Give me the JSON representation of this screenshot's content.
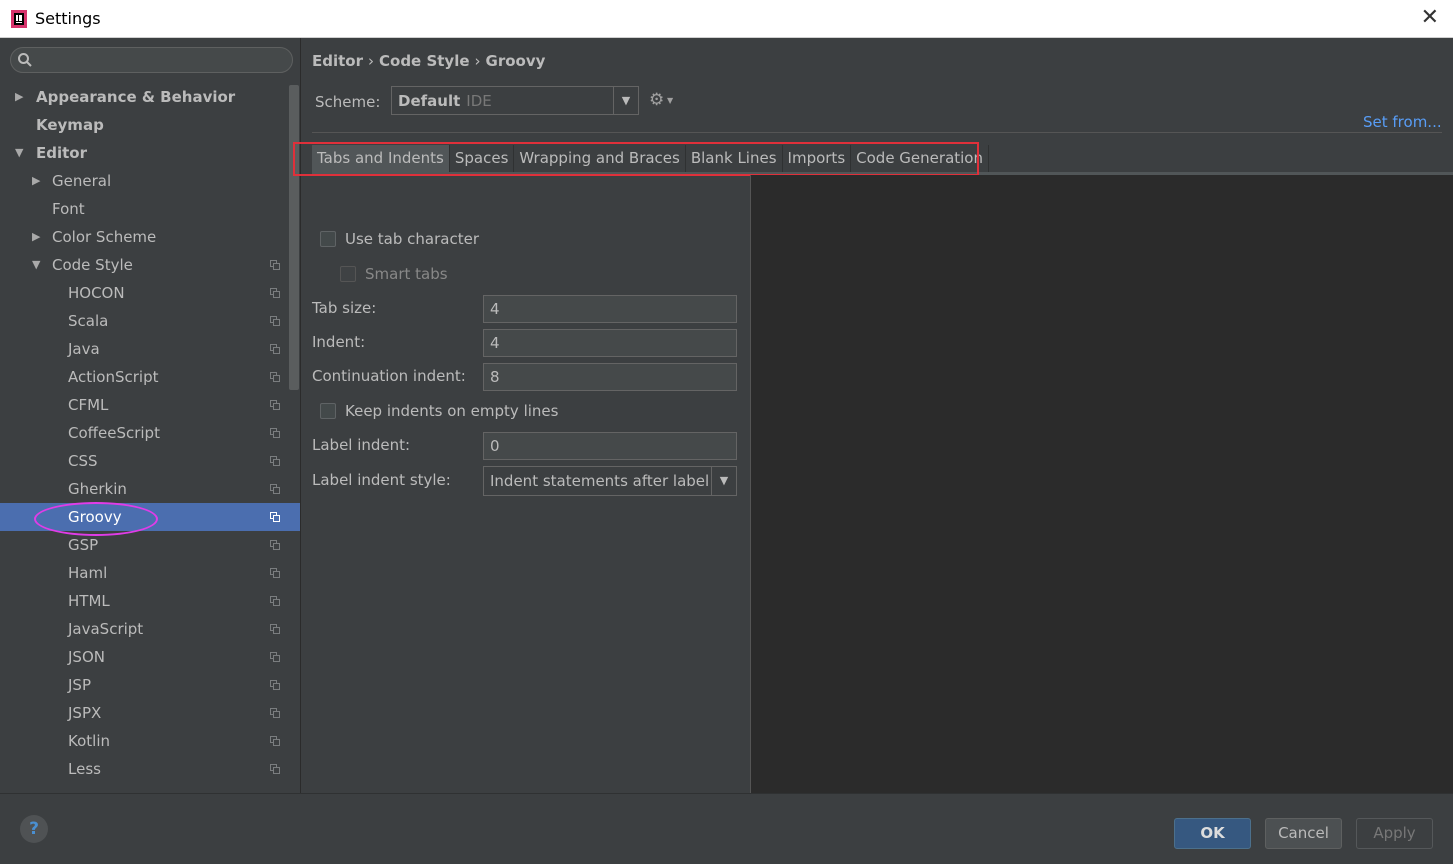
{
  "window": {
    "title": "Settings"
  },
  "sidebar": {
    "search_placeholder": "",
    "items": [
      {
        "label": "Appearance & Behavior",
        "level": 0,
        "arrow": "▶",
        "bold": true,
        "copy": false,
        "selected": false
      },
      {
        "label": "Keymap",
        "level": 0,
        "arrow": "",
        "bold": true,
        "copy": false,
        "selected": false
      },
      {
        "label": "Editor",
        "level": 0,
        "arrow": "▼",
        "bold": true,
        "copy": false,
        "selected": false
      },
      {
        "label": "General",
        "level": 1,
        "arrow": "▶",
        "bold": false,
        "copy": false,
        "selected": false
      },
      {
        "label": "Font",
        "level": 1,
        "arrow": "",
        "bold": false,
        "copy": false,
        "selected": false
      },
      {
        "label": "Color Scheme",
        "level": 1,
        "arrow": "▶",
        "bold": false,
        "copy": false,
        "selected": false
      },
      {
        "label": "Code Style",
        "level": 1,
        "arrow": "▼",
        "bold": false,
        "copy": true,
        "selected": false
      },
      {
        "label": "HOCON",
        "level": 2,
        "arrow": "",
        "bold": false,
        "copy": true,
        "selected": false
      },
      {
        "label": "Scala",
        "level": 2,
        "arrow": "",
        "bold": false,
        "copy": true,
        "selected": false
      },
      {
        "label": "Java",
        "level": 2,
        "arrow": "",
        "bold": false,
        "copy": true,
        "selected": false
      },
      {
        "label": "ActionScript",
        "level": 2,
        "arrow": "",
        "bold": false,
        "copy": true,
        "selected": false
      },
      {
        "label": "CFML",
        "level": 2,
        "arrow": "",
        "bold": false,
        "copy": true,
        "selected": false
      },
      {
        "label": "CoffeeScript",
        "level": 2,
        "arrow": "",
        "bold": false,
        "copy": true,
        "selected": false
      },
      {
        "label": "CSS",
        "level": 2,
        "arrow": "",
        "bold": false,
        "copy": true,
        "selected": false
      },
      {
        "label": "Gherkin",
        "level": 2,
        "arrow": "",
        "bold": false,
        "copy": true,
        "selected": false
      },
      {
        "label": "Groovy",
        "level": 2,
        "arrow": "",
        "bold": false,
        "copy": true,
        "selected": true
      },
      {
        "label": "GSP",
        "level": 2,
        "arrow": "",
        "bold": false,
        "copy": true,
        "selected": false
      },
      {
        "label": "Haml",
        "level": 2,
        "arrow": "",
        "bold": false,
        "copy": true,
        "selected": false
      },
      {
        "label": "HTML",
        "level": 2,
        "arrow": "",
        "bold": false,
        "copy": true,
        "selected": false
      },
      {
        "label": "JavaScript",
        "level": 2,
        "arrow": "",
        "bold": false,
        "copy": true,
        "selected": false
      },
      {
        "label": "JSON",
        "level": 2,
        "arrow": "",
        "bold": false,
        "copy": true,
        "selected": false
      },
      {
        "label": "JSP",
        "level": 2,
        "arrow": "",
        "bold": false,
        "copy": true,
        "selected": false
      },
      {
        "label": "JSPX",
        "level": 2,
        "arrow": "",
        "bold": false,
        "copy": true,
        "selected": false
      },
      {
        "label": "Kotlin",
        "level": 2,
        "arrow": "",
        "bold": false,
        "copy": true,
        "selected": false
      },
      {
        "label": "Less",
        "level": 2,
        "arrow": "",
        "bold": false,
        "copy": true,
        "selected": false
      }
    ]
  },
  "breadcrumb": {
    "part1": "Editor",
    "part2": "Code Style",
    "part3": "Groovy",
    "sep": "›"
  },
  "scheme": {
    "label": "Scheme:",
    "value": "Default",
    "sub": "IDE",
    "gear_icon": "gear-icon"
  },
  "set_from": "Set from...",
  "tabs": [
    "Tabs and Indents",
    "Spaces",
    "Wrapping and Braces",
    "Blank Lines",
    "Imports",
    "Code Generation"
  ],
  "form": {
    "use_tab_character": "Use tab character",
    "smart_tabs": "Smart tabs",
    "tab_size_label": "Tab size:",
    "tab_size_value": "4",
    "indent_label": "Indent:",
    "indent_value": "4",
    "continuation_label": "Continuation indent:",
    "continuation_value": "8",
    "keep_indents": "Keep indents on empty lines",
    "label_indent_label": "Label indent:",
    "label_indent_value": "0",
    "label_indent_style_label": "Label indent style:",
    "label_indent_style_value": "Indent statements after label"
  },
  "footer": {
    "help": "?",
    "ok": "OK",
    "cancel": "Cancel",
    "apply": "Apply"
  },
  "colors": {
    "accent_blue": "#4b6eaf",
    "link": "#589df6",
    "highlight_red": "#e0303a",
    "highlight_magenta": "#e03ce8"
  }
}
